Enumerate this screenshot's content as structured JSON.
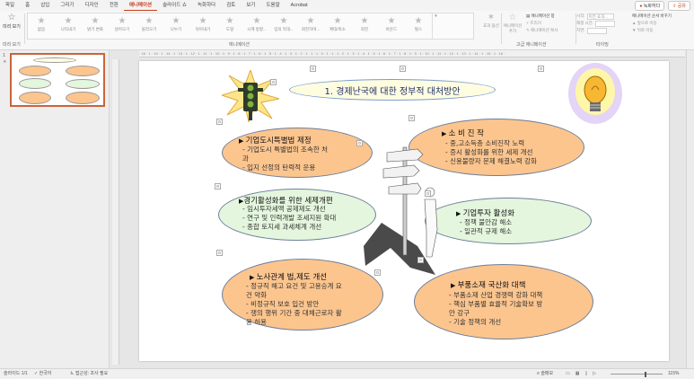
{
  "tabs": [
    "파일",
    "홈",
    "삽입",
    "그리기",
    "디자인",
    "전환",
    "애니메이션",
    "슬라이드 쇼",
    "녹화하다",
    "검토",
    "보기",
    "도움말",
    "Acrobat"
  ],
  "active_tab": "애니메이션",
  "top_right": {
    "record": "녹화하다",
    "share": "공유"
  },
  "ribbon": {
    "preview": {
      "label": "미리 보기",
      "group": "미리 보기"
    },
    "animations": [
      "없음",
      "나타내기",
      "밝기 변화",
      "날아오기",
      "올라오기",
      "나누기",
      "닦아내기",
      "도형",
      "시계 방향...",
      "임의 막대...",
      "회전하며...",
      "확대/축소",
      "회전",
      "바운드",
      "펄스"
    ],
    "animation_group": "애니메이션",
    "effect_options": "효과 옵션",
    "advanced": {
      "add": "애니메이션 추가",
      "pane": "애니메이션 창",
      "trigger": "트리거",
      "painter": "애니메이션 복사",
      "group": "고급 애니메이션"
    },
    "timing": {
      "start_label": "시작:",
      "start_value": "이전 효과...",
      "duration_label": "재생 시간:",
      "delay_label": "지연:",
      "group": "타이밍"
    },
    "reorder": {
      "title": "애니메이션 순서 바꾸기",
      "earlier": "앞으로 이동",
      "later": "뒤로 이동"
    }
  },
  "thumbnail": {
    "number": "1",
    "star": "★"
  },
  "slide": {
    "title": "1. 경제난국에 대한 정부적 대처방안",
    "boxes": [
      {
        "head": "기업도시특별법 제정",
        "lines": [
          "- 기업도시 특별법의 조속한 처",
          "과",
          "- 입지 선정의 탄력적 운용"
        ]
      },
      {
        "head": "소 비 진 작",
        "lines": [
          "- 중,고소득층 소비진작 노력",
          "- 증시 활성화를 위한 세제 개선",
          "- 신용불량자 문제 해결노력 강화"
        ]
      },
      {
        "head": "경기활성화를 위한 세제개편",
        "lines": [
          "- 임시투자세액 공제제도 개선",
          "- 연구 및 인력개발 조세지원 확대",
          "- 종합 토지세 과세체계 개선"
        ]
      },
      {
        "head": "기업투자 활성화",
        "lines": [
          "- 정책 불안감 해소",
          "- 일관적 규제 해소"
        ]
      },
      {
        "head": "노사관계 법,제도 개선",
        "lines": [
          "- 정규직 해고 요건 및 고용승계 요",
          "건 약화",
          "- 비정규직 보호 입건 방안",
          "- 쟁의 행위 기간 중 대체근로자 활",
          "용 허용"
        ]
      },
      {
        "head": "부품소재 국산화 대책",
        "lines": [
          "- 부품소재 산업 경쟁력 강화 대책",
          "- 핵심 부품별 효율적 기술확보 방",
          "안 강구",
          "- 기술 정책의 개선"
        ]
      }
    ],
    "markers": [
      "0",
      "0",
      "0",
      "0",
      "0",
      "0",
      "0",
      "0",
      "0",
      "0",
      "0",
      "0"
    ]
  },
  "ruler_text": "· 16 · 1 · 15 · 1 · 14 · 1 · 13 · 1 · 12 · 1 · 11 · 1 · 10 · 1 · 9 · 1 · 8 · 1 · 7 · 1 · 6 · 1 · 5 · 1 · 4 · 1 · 3 · 1 · 2 · 1 · 1 · 1 · 0 · 1 · 1 · 1 · 2 · 1 · 3 · 1 · 4 · 1 · 5 · 1 · 6 · 1 · 7 · 1 · 8 · 1 · 9 · 1 · 10 · 1 · 11 · 1 · 12 · 1 · 13 · 1 · 14 · 1 · 15 · 1 · 16 ·",
  "status": {
    "slide": "슬라이드 1/1",
    "language": "한국어",
    "accessibility": "접근성: 조사 필요",
    "notes": "슬메모",
    "zoom": "115%"
  },
  "colors": {
    "accent": "#c43e1c",
    "orange_box": "#fcc58e",
    "green_box": "#e4f6dd",
    "title_fill": "#fffde0"
  }
}
